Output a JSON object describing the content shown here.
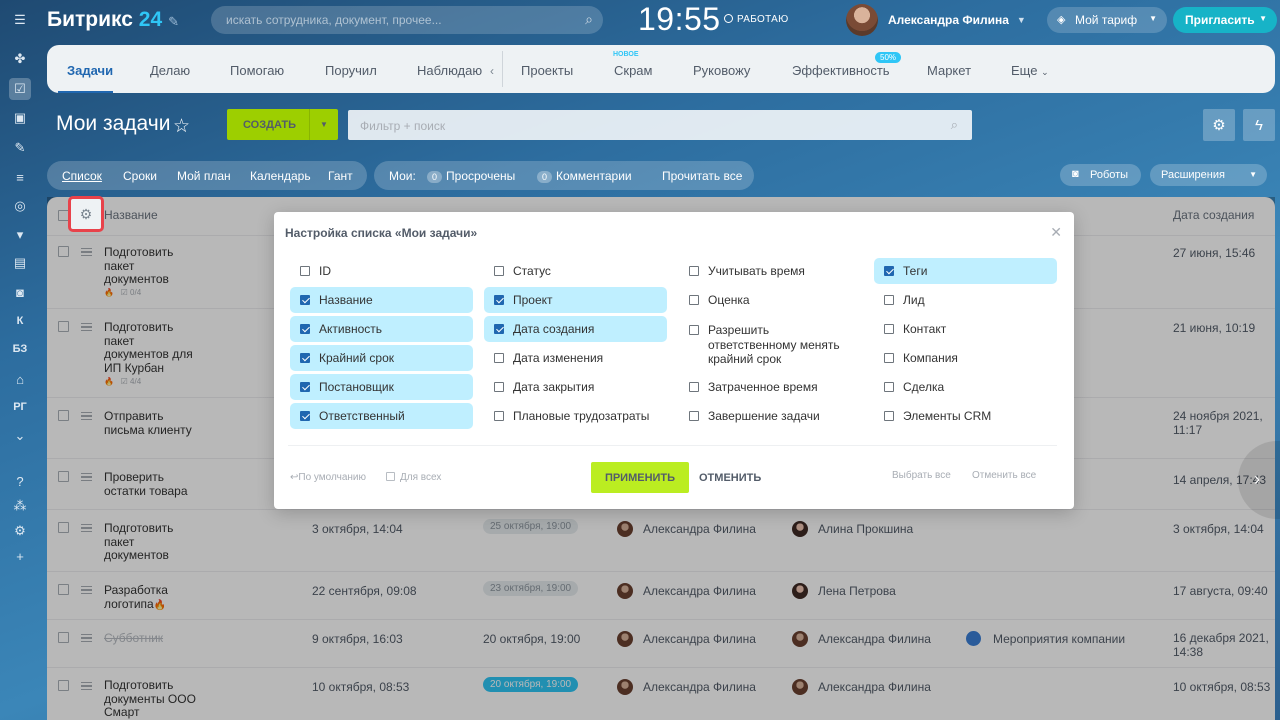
{
  "header": {
    "logo_text": "Битрикс",
    "logo_num": "24",
    "search_placeholder": "искать сотрудника, документ, прочее...",
    "clock": "19:55",
    "work_status": "РАБОТАЮ",
    "user_name": "Александра Филина",
    "plan_label": "Мой тариф",
    "invite_label": "Пригласить"
  },
  "rail": {
    "items": [
      "К",
      "БЗ",
      "РГ"
    ]
  },
  "top_tabs": {
    "items": [
      {
        "label": "Задачи"
      },
      {
        "label": "Делаю"
      },
      {
        "label": "Помогаю"
      },
      {
        "label": "Поручил"
      },
      {
        "label": "Наблюдаю"
      },
      {
        "label": "Проекты"
      },
      {
        "label": "Скрам"
      },
      {
        "label": "Руковожу"
      },
      {
        "label": "Эффективность"
      },
      {
        "label": "Маркет"
      },
      {
        "label": "Еще"
      }
    ],
    "new_badge": "НОВОЕ",
    "efficiency_badge": "50%"
  },
  "page": {
    "title": "Мои задачи",
    "create_label": "СОЗДАТЬ",
    "filter_placeholder": "Фильтр + поиск"
  },
  "view_bar": {
    "views": [
      "Список",
      "Сроки",
      "Мой план",
      "Календарь",
      "Гант"
    ],
    "mine_label": "Мои:",
    "overdue_count": "0",
    "overdue_label": "Просрочены",
    "comments_count": "0",
    "comments_label": "Комментарии",
    "read_all": "Прочитать все",
    "robots": "Роботы",
    "extensions": "Расширения"
  },
  "grid": {
    "col_name": "Название",
    "col_created": "Дата создания",
    "rows": [
      {
        "name": "Подготовить пакет документов",
        "meta": "0/4",
        "created": "27 июня, 15:46"
      },
      {
        "name": "Подготовить пакет документов для ИП Курбан",
        "meta": "4/4",
        "created": "21 июня, 10:19"
      },
      {
        "name": "Отправить письма клиенту",
        "created": "24 ноября 2021, 11:17"
      },
      {
        "name": "Проверить остатки товара",
        "created": "14 апреля, 17:43"
      },
      {
        "name": "Подготовить пакет документов",
        "activity": "3 октября, 14:04",
        "deadline": "25 октября, 19:00",
        "creator": "Александра Филина",
        "responsible": "Алина Прокшина",
        "created": "3 октября, 14:04"
      },
      {
        "name": "Разработка логотипа",
        "activity": "22 сентября, 09:08",
        "deadline": "23 октября, 19:00",
        "creator": "Александра Филина",
        "responsible": "Лена Петрова",
        "created": "17 августа, 09:40"
      },
      {
        "name": "Субботник",
        "activity": "9 октября, 16:03",
        "deadline": "20 октября, 19:00",
        "creator": "Александра Филина",
        "responsible": "Александра Филина",
        "project": "Мероприятия компании",
        "created": "16 декабря 2021, 14:38"
      },
      {
        "name": "Подготовить документы ООО Смарт",
        "activity": "10 октября, 08:53",
        "deadline": "20 октября, 19:00",
        "creator": "Александра Филина",
        "responsible": "Александра Филина",
        "created": "10 октября, 08:53"
      }
    ]
  },
  "dialog": {
    "title": "Настройка списка «Мои задачи»",
    "columns": [
      [
        {
          "label": "ID",
          "checked": false
        },
        {
          "label": "Название",
          "checked": true
        },
        {
          "label": "Активность",
          "checked": true
        },
        {
          "label": "Крайний срок",
          "checked": true
        },
        {
          "label": "Постановщик",
          "checked": true
        },
        {
          "label": "Ответственный",
          "checked": true
        }
      ],
      [
        {
          "label": "Статус",
          "checked": false
        },
        {
          "label": "Проект",
          "checked": true
        },
        {
          "label": "Дата создания",
          "checked": true
        },
        {
          "label": "Дата изменения",
          "checked": false
        },
        {
          "label": "Дата закрытия",
          "checked": false
        },
        {
          "label": "Плановые трудозатраты",
          "checked": false
        }
      ],
      [
        {
          "label": "Учитывать время",
          "checked": false
        },
        {
          "label": "Оценка",
          "checked": false
        },
        {
          "label": "Разрешить ответственному менять крайний срок",
          "checked": false
        },
        {
          "label": "Затраченное время",
          "checked": false
        },
        {
          "label": "Завершение задачи",
          "checked": false
        }
      ],
      [
        {
          "label": "Теги",
          "checked": true
        },
        {
          "label": "Лид",
          "checked": false
        },
        {
          "label": "Контакт",
          "checked": false
        },
        {
          "label": "Компания",
          "checked": false
        },
        {
          "label": "Сделка",
          "checked": false
        },
        {
          "label": "Элементы CRM",
          "checked": false
        }
      ]
    ],
    "default_label": "По умолчанию",
    "for_all_label": "Для всех",
    "apply_label": "ПРИМЕНИТЬ",
    "cancel_label": "ОТМЕНИТЬ",
    "select_all_label": "Выбрать все",
    "deselect_all_label": "Отменить все"
  }
}
